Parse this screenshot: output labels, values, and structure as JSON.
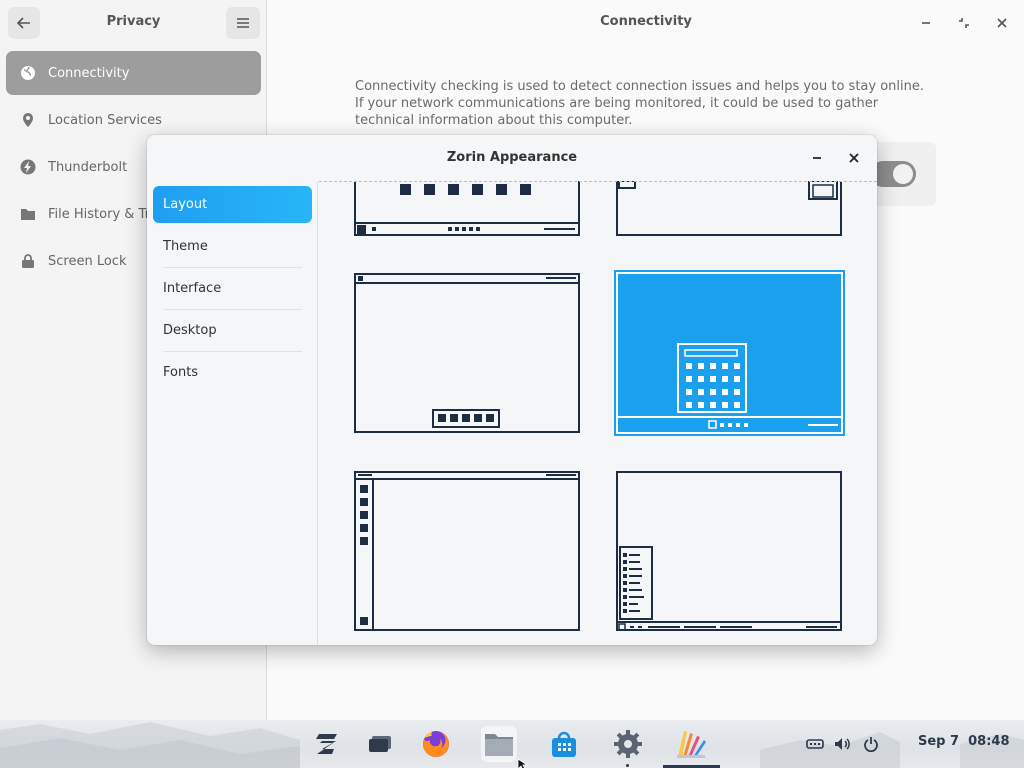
{
  "settings": {
    "sidebar_title": "Privacy",
    "main_title": "Connectivity",
    "description": "Connectivity checking is used to detect connection issues and helps you to stay online. If your network communications are being monitored, it could be used to gather technical information about this computer.",
    "nav": [
      {
        "label": "Connectivity",
        "icon": "globe-icon",
        "active": true
      },
      {
        "label": "Location Services",
        "icon": "location-pin-icon"
      },
      {
        "label": "Thunderbolt",
        "icon": "thunderbolt-icon"
      },
      {
        "label": "File History & Trash",
        "icon": "folder-icon"
      },
      {
        "label": "Screen Lock",
        "icon": "lock-icon"
      }
    ],
    "toggle_on": true
  },
  "dialog": {
    "title": "Zorin Appearance",
    "tabs": [
      {
        "label": "Layout",
        "active": true
      },
      {
        "label": "Theme"
      },
      {
        "label": "Interface"
      },
      {
        "label": "Desktop"
      },
      {
        "label": "Fonts"
      }
    ],
    "layouts_selected": 3
  },
  "taskbar": {
    "apps": [
      "zorin-menu-icon",
      "workspaces-icon",
      "firefox-icon",
      "files-icon",
      "software-store-icon",
      "settings-gear-icon",
      "appearance-icon"
    ],
    "tray": [
      "network-icon",
      "volume-icon",
      "power-icon"
    ],
    "clock_date": "Sep 7",
    "clock_time": "08:48"
  },
  "colors": {
    "accent": "#1aa0ec",
    "outline": "#1d2d44",
    "active_nav": "#9d9d9d"
  }
}
